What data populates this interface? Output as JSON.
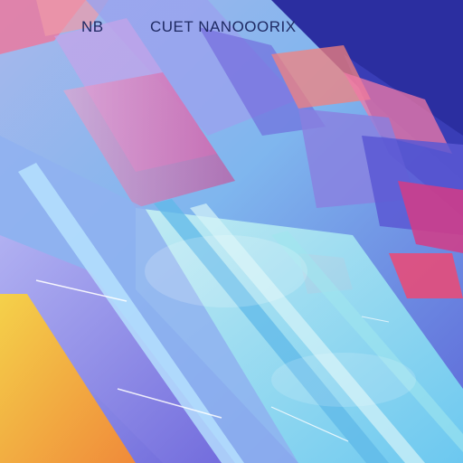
{
  "caption": {
    "left": "NB",
    "right": "CUET NANOOORIX"
  },
  "palette": {
    "deep_blue": "#2b2ea0",
    "violet": "#6b5bd8",
    "periwinkle": "#8fb2f0",
    "sky": "#6ed3f2",
    "aqua": "#8ee0e0",
    "pink": "#f07aa6",
    "magenta": "#d43c86",
    "coral": "#f3817d",
    "yellow": "#f6c13c",
    "orange": "#f08a3a"
  }
}
